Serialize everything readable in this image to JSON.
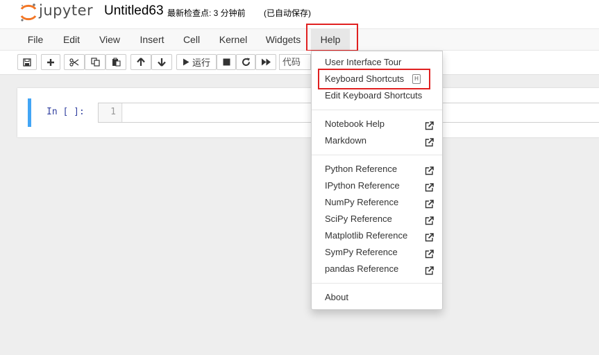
{
  "header": {
    "logo_text": "jupyter",
    "notebook_title": "Untitled63",
    "checkpoint": "最新检查点: 3 分钟前",
    "autosave": "(已自动保存)"
  },
  "menubar": {
    "items": [
      {
        "label": "File"
      },
      {
        "label": "Edit"
      },
      {
        "label": "View"
      },
      {
        "label": "Insert"
      },
      {
        "label": "Cell"
      },
      {
        "label": "Kernel"
      },
      {
        "label": "Widgets"
      },
      {
        "label": "Help"
      }
    ]
  },
  "toolbar": {
    "run_label": "运行",
    "cell_type": "代码",
    "icons": [
      "save-icon",
      "plus-icon",
      "scissors-icon",
      "copy-icon",
      "paste-icon",
      "arrow-up-icon",
      "arrow-down-icon",
      "play-icon",
      "stop-icon",
      "restart-icon",
      "fast-forward-icon"
    ]
  },
  "cell": {
    "prompt": "In [ ]:",
    "line_number": "1"
  },
  "help_menu": {
    "items": [
      {
        "label": "User Interface Tour"
      },
      {
        "label": "Keyboard Shortcuts",
        "shortcut": "H"
      },
      {
        "label": "Edit Keyboard Shortcuts"
      },
      {
        "label": "Notebook Help"
      },
      {
        "label": "Markdown"
      },
      {
        "label": "Python Reference"
      },
      {
        "label": "IPython Reference"
      },
      {
        "label": "NumPy Reference"
      },
      {
        "label": "SciPy Reference"
      },
      {
        "label": "Matplotlib Reference"
      },
      {
        "label": "SymPy Reference"
      },
      {
        "label": "pandas Reference"
      },
      {
        "label": "About"
      }
    ]
  },
  "colors": {
    "highlight": "#e02020",
    "cell_focus": "#42a5f5",
    "logo_orange": "#f37726"
  }
}
